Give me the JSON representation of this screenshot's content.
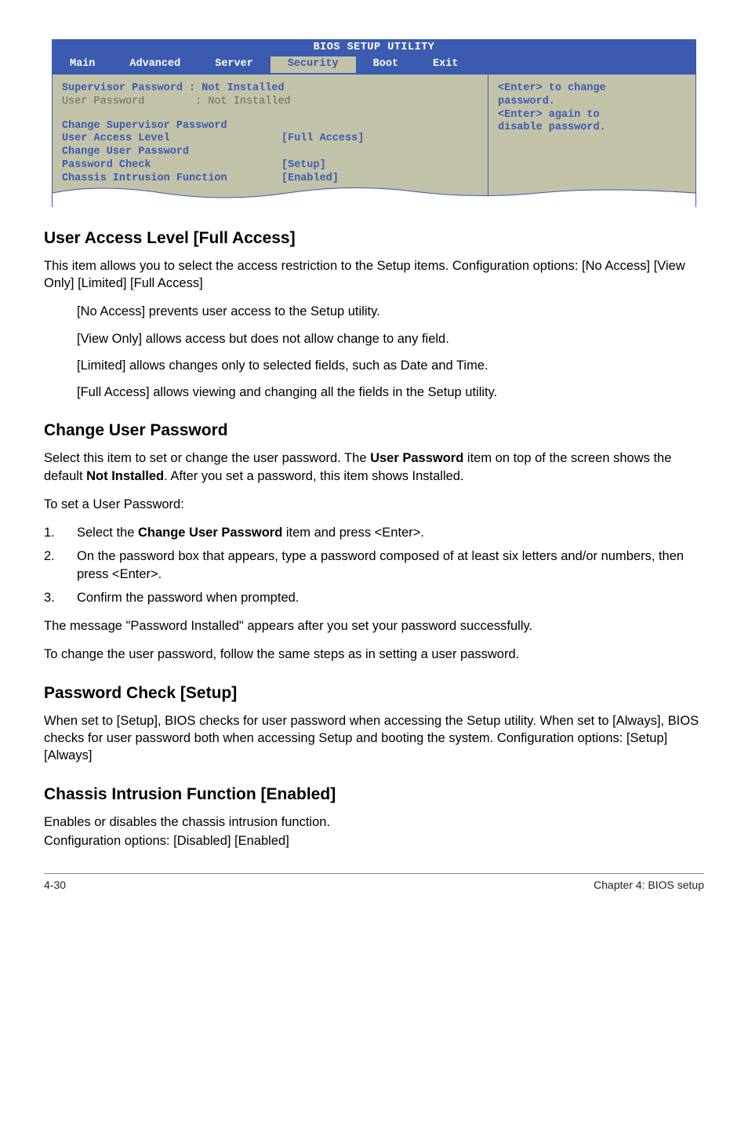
{
  "bios": {
    "utility_title": "BIOS SETUP UTILITY",
    "tabs": {
      "main": "Main",
      "advanced": "Advanced",
      "server": "Server",
      "security": "Security",
      "boot": "Boot",
      "exit": "Exit"
    },
    "left": {
      "sup_label": "Supervisor Password : ",
      "sup_value": "Not Installed",
      "user_label": "User Password        : ",
      "user_value": "Not Installed",
      "change_sup": "Change Supervisor Password",
      "ual_label": "User Access Level",
      "ual_value": "[Full Access]",
      "change_user": "Change User Password",
      "pwcheck_label": "Password Check",
      "pwcheck_value": "[Setup]",
      "chassis_label": "Chassis Intrusion Function",
      "chassis_value": "[Enabled]"
    },
    "help": {
      "l1": "<Enter> to change",
      "l2": "password.",
      "l3": "<Enter> again to",
      "l4": "disable password."
    }
  },
  "sections": {
    "ual_heading": "User Access Level [Full Access]",
    "ual_p1": "This item allows you to select the access restriction to the Setup items. Configuration options: [No Access] [View Only] [Limited] [Full Access]",
    "ual_opts": {
      "o1": "[No Access] prevents user access to the Setup utility.",
      "o2": "[View Only] allows access but does not allow change to any field.",
      "o3": "[Limited] allows changes only to selected fields, such as Date and Time.",
      "o4": "[Full Access] allows viewing and changing all the fields in the Setup utility."
    },
    "cup_heading": "Change User Password",
    "cup_p1a": "Select this item to set or change the user password. The ",
    "cup_p1b": "User Password",
    "cup_p1c": " item on top of the screen shows the default ",
    "cup_p1d": "Not Installed",
    "cup_p1e": ". After you set a password, this item shows Installed.",
    "cup_p2": "To set a User Password:",
    "steps": {
      "s1a": "Select the ",
      "s1b": "Change User Password",
      "s1c": " item and press <Enter>.",
      "s2": "On the password box that appears, type a password composed of at least six letters and/or numbers, then press <Enter>.",
      "s3": "Confirm the password when prompted."
    },
    "cup_p3": "The message \"Password Installed\" appears after you set your password successfully.",
    "cup_p4": "To change the user password, follow the same steps as in setting a user password.",
    "pwc_heading": "Password Check [Setup]",
    "pwc_p1": "When set to [Setup], BIOS checks for user password when accessing the Setup utility. When set to [Always], BIOS checks for user password both when accessing Setup and booting the system. Configuration options: [Setup] [Always]",
    "cif_heading": "Chassis Intrusion Function [Enabled]",
    "cif_p1": "Enables or disables the chassis intrusion function.",
    "cif_p2": "Configuration options: [Disabled] [Enabled]"
  },
  "footer": {
    "left": "4-30",
    "right": "Chapter 4: BIOS setup"
  }
}
